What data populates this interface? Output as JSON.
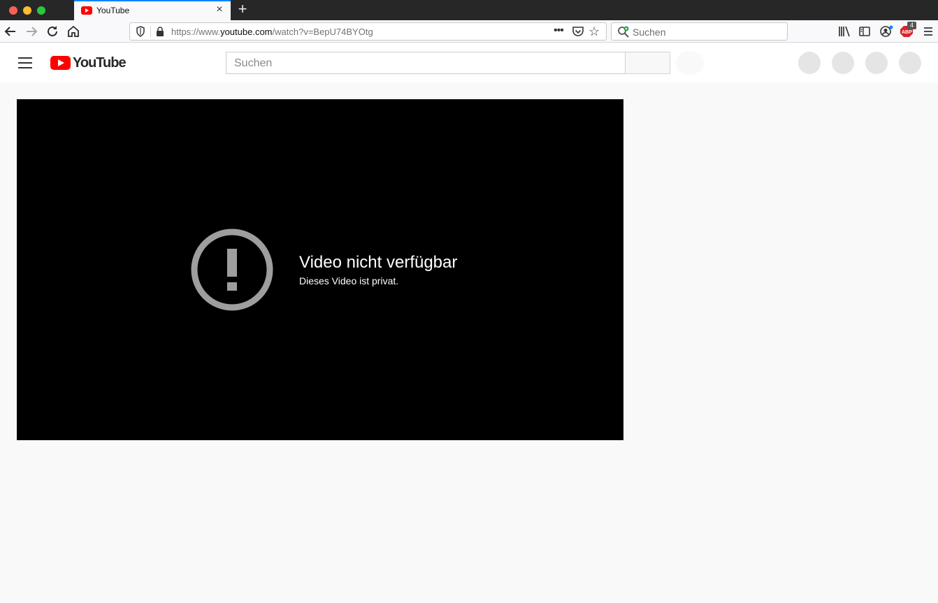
{
  "browser": {
    "tab": {
      "title": "YouTube",
      "close_glyph": "×"
    },
    "new_tab_glyph": "+",
    "url": {
      "prefix": "https://www.",
      "host": "youtube.com",
      "path": "/watch?v=BepU74BYOtg"
    },
    "url_more_glyph": "•••",
    "bookmark_glyph": "☆",
    "search_placeholder": "Suchen",
    "abp_badge": "4",
    "accent_color": "#0a84ff"
  },
  "youtube": {
    "logo_text": "YouTube",
    "search_placeholder": "Suchen",
    "brand_color": "#ff0000"
  },
  "player": {
    "error_title": "Video nicht verfügbar",
    "error_subtitle": "Dieses Video ist privat."
  }
}
